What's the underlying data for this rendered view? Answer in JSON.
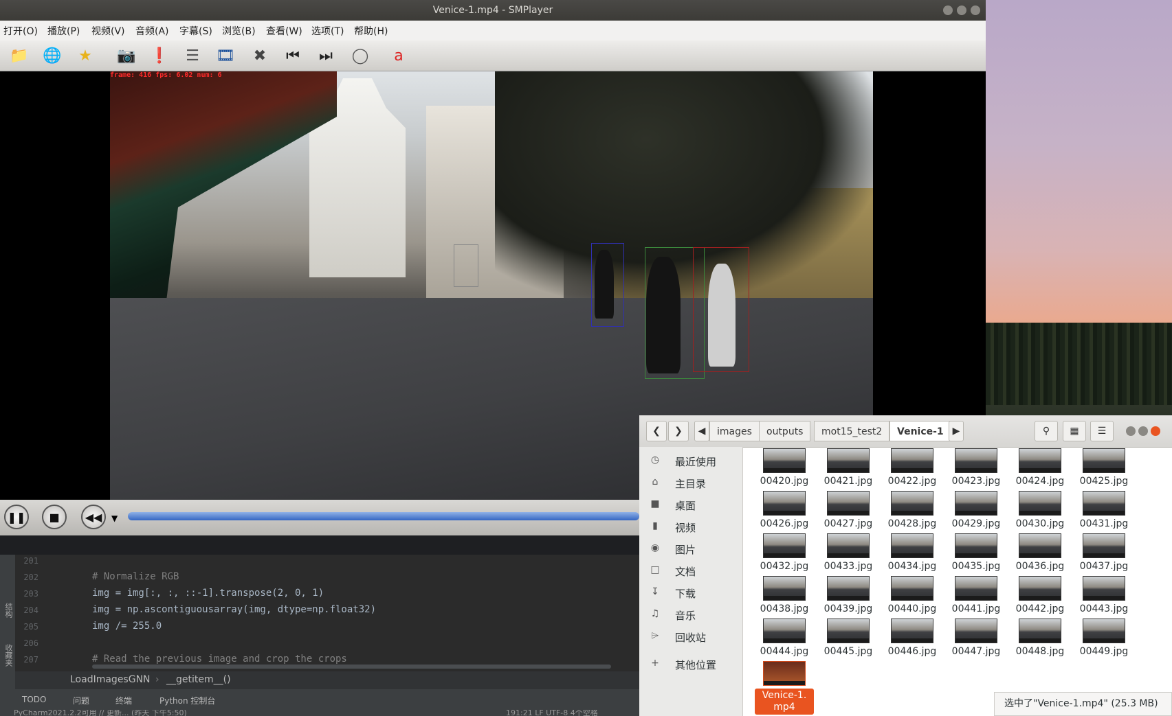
{
  "window": {
    "title": "Venice-1.mp4 - SMPlayer"
  },
  "menu": [
    "打开(O)",
    "播放(P)",
    "视频(V)",
    "音频(A)",
    "字幕(S)",
    "浏览(B)",
    "查看(W)",
    "选项(T)",
    "帮助(H)"
  ],
  "toolbar": {
    "icons": [
      "folder-icon",
      "globe-icon",
      "star-icon",
      "camera-icon",
      "info-icon",
      "playlist-icon",
      "film-icon",
      "tools-icon",
      "previous-icon",
      "next-icon",
      "eye-icon",
      "subtitle-icon"
    ]
  },
  "video": {
    "overlay": "frame: 416  fps: 6.02  num: 6"
  },
  "editor": {
    "lines": [
      {
        "num": "201",
        "code": ""
      },
      {
        "num": "202",
        "code": "# Normalize RGB"
      },
      {
        "num": "203",
        "code": "img = img[:, :, ::-1].transpose(2, 0, 1)"
      },
      {
        "num": "204",
        "code": "img = np.ascontiguousarray(img, dtype=np.float32)"
      },
      {
        "num": "205",
        "code": "img /= 255.0"
      },
      {
        "num": "206",
        "code": ""
      },
      {
        "num": "207",
        "code": "# Read the previous image and crop the crops"
      }
    ],
    "side_labels": [
      "结构",
      "收藏夹"
    ],
    "breadcrumb": [
      "LoadImagesGNN",
      "__getitem__()"
    ],
    "bottom_tabs": [
      "TODO",
      "问题",
      "终端",
      "Python 控制台"
    ],
    "status": "PyCharm2021.2.2可用 // 更新... (昨天 下午5:50)",
    "status_right": "191:21  LF  UTF-8  4个空格"
  },
  "files": {
    "path": [
      "images",
      "outputs",
      "mot15_test2",
      "Venice-1"
    ],
    "sidebar": [
      {
        "icon": "clock-icon",
        "label": "最近使用"
      },
      {
        "icon": "home-icon",
        "label": "主目录"
      },
      {
        "icon": "folder-icon",
        "label": "桌面"
      },
      {
        "icon": "video-icon",
        "label": "视频"
      },
      {
        "icon": "camera-icon",
        "label": "图片"
      },
      {
        "icon": "document-icon",
        "label": "文档"
      },
      {
        "icon": "download-icon",
        "label": "下载"
      },
      {
        "icon": "music-icon",
        "label": "音乐"
      },
      {
        "icon": "trash-icon",
        "label": "回收站"
      },
      {
        "icon": "plus-icon",
        "label": "其他位置"
      }
    ],
    "items": [
      "00420.jpg",
      "00421.jpg",
      "00422.jpg",
      "00423.jpg",
      "00424.jpg",
      "00425.jpg",
      "00426.jpg",
      "00427.jpg",
      "00428.jpg",
      "00429.jpg",
      "00430.jpg",
      "00431.jpg",
      "00432.jpg",
      "00433.jpg",
      "00434.jpg",
      "00435.jpg",
      "00436.jpg",
      "00437.jpg",
      "00438.jpg",
      "00439.jpg",
      "00440.jpg",
      "00441.jpg",
      "00442.jpg",
      "00443.jpg",
      "00444.jpg",
      "00445.jpg",
      "00446.jpg",
      "00447.jpg",
      "00448.jpg",
      "00449.jpg",
      "Venice-1.\nmp4"
    ],
    "selected_index": 30,
    "toast": "选中了\"Venice-1.mp4\" (25.3 MB)"
  },
  "colors": {
    "accent": "#e95420",
    "seek": "#3567c2"
  }
}
